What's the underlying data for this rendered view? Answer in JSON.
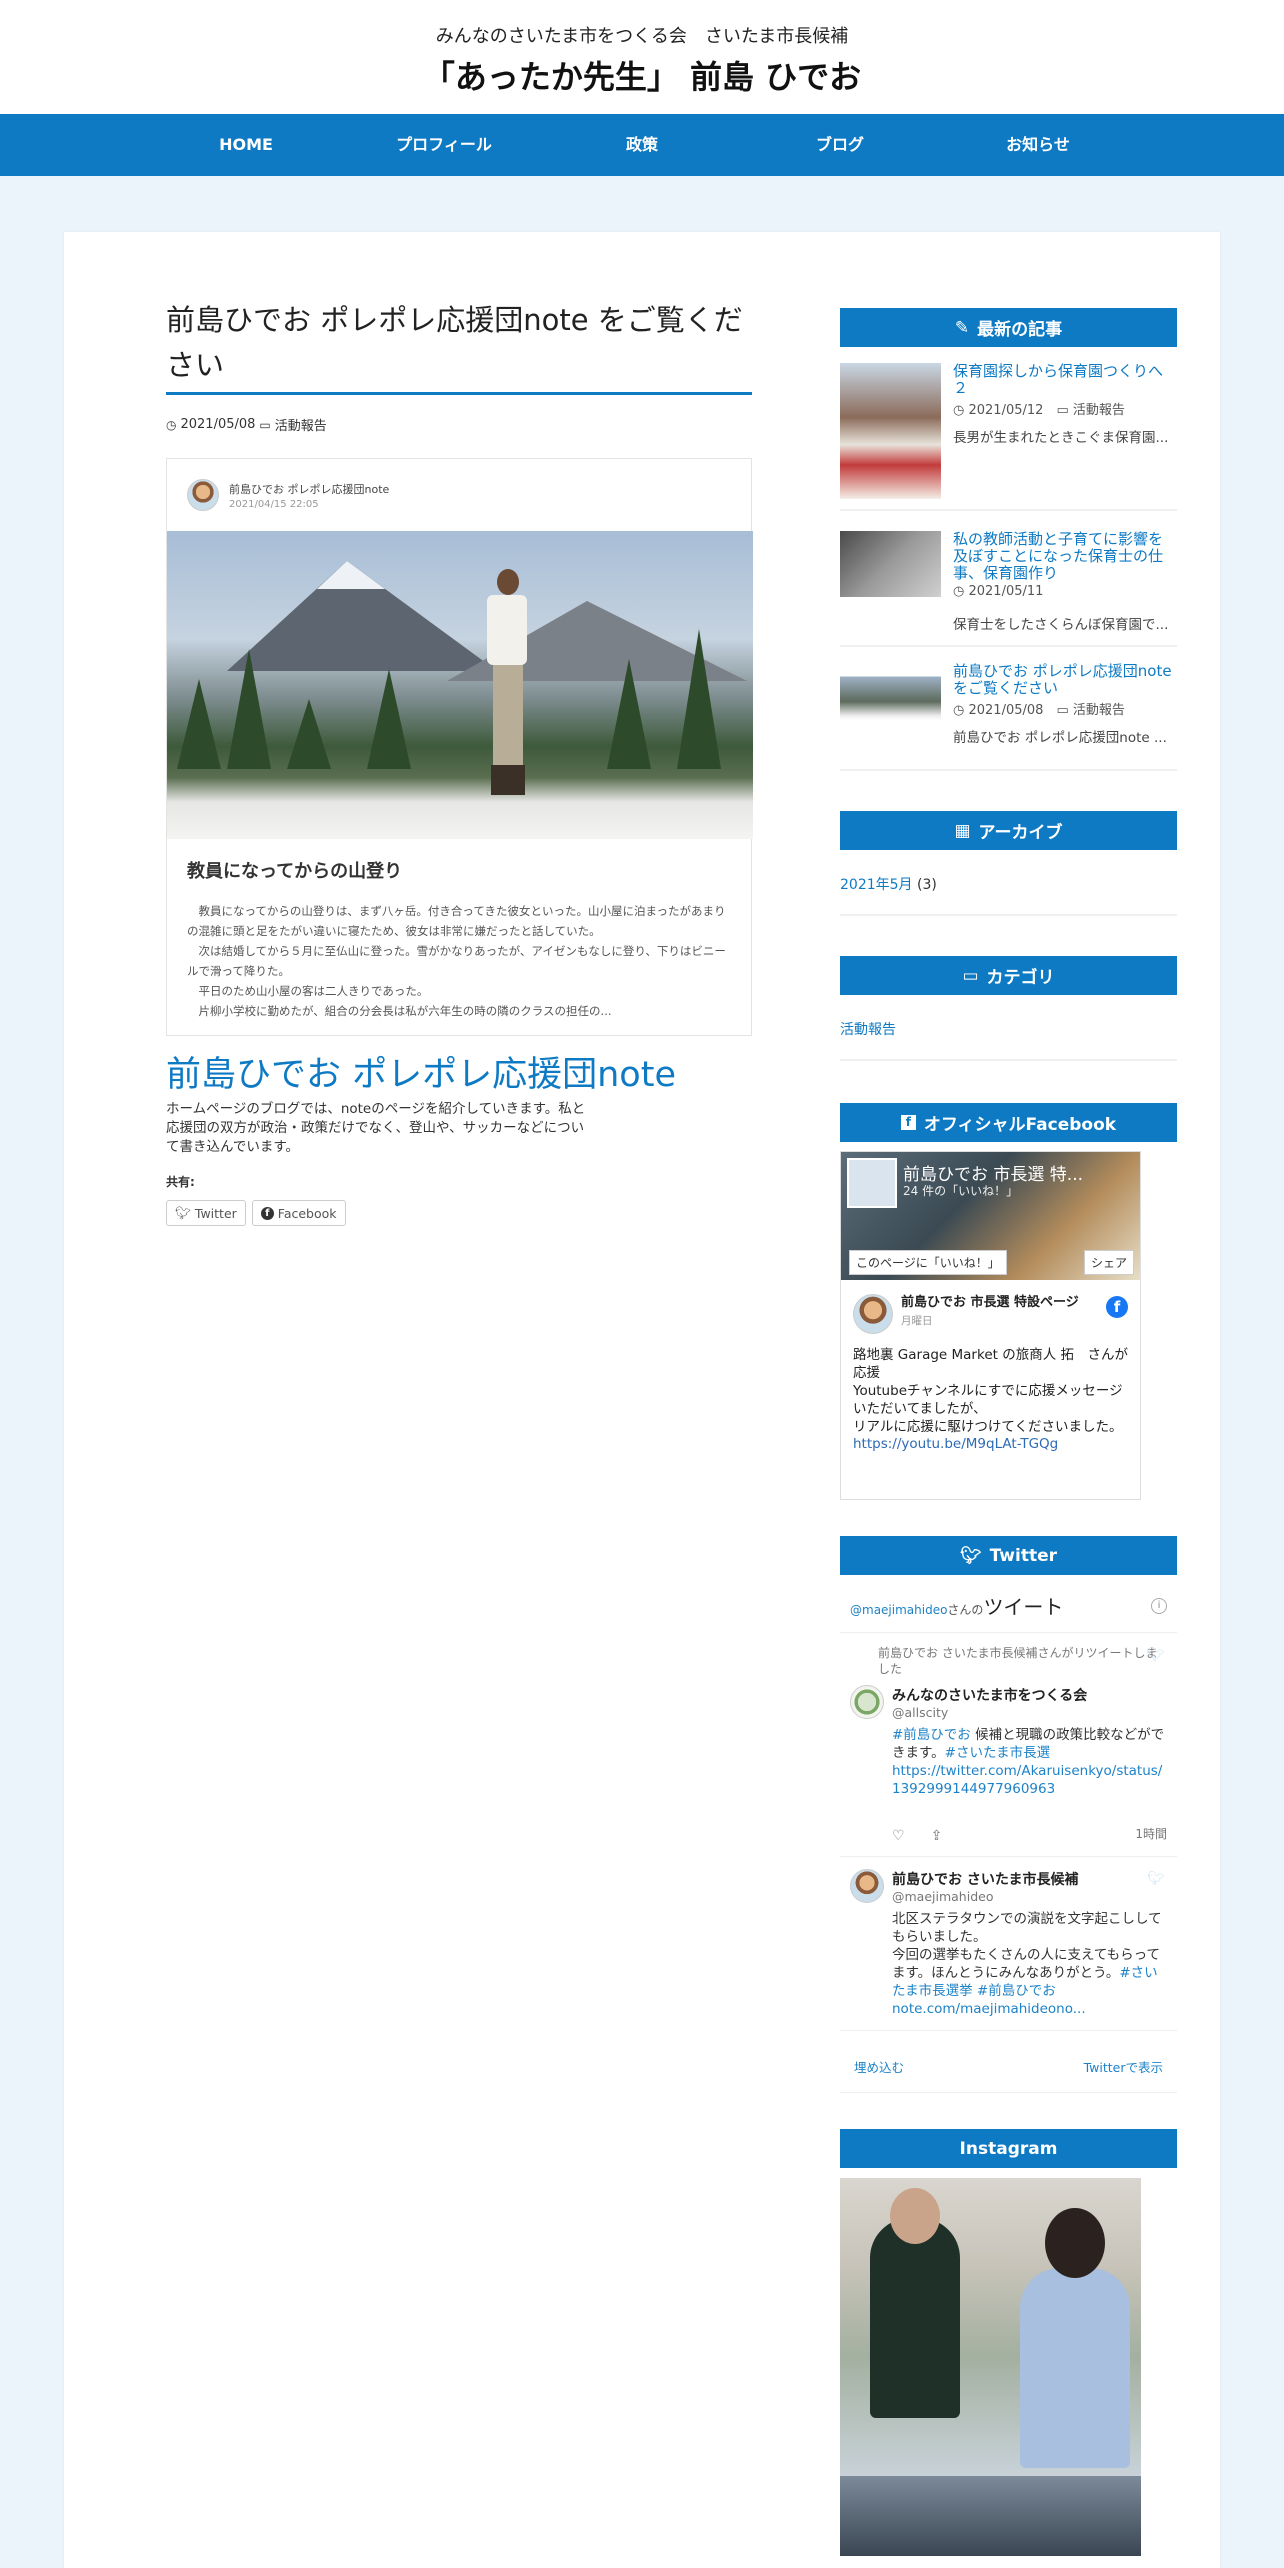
{
  "header": {
    "tagline": "みんなのさいたま市をつくる会　さいたま市長候補",
    "title": "「あったか先生」 前島 ひでお"
  },
  "nav": [
    "HOME",
    "プロフィール",
    "政策",
    "ブログ",
    "お知らせ"
  ],
  "article": {
    "title": "前島ひでお ポレポレ応援団note をご覧ください",
    "date": "2021/05/08",
    "category": "活動報告",
    "embed": {
      "author": "前島ひでお ポレポレ応援団note",
      "datetime": "2021/04/15 22:05",
      "heading": "教員になってからの山登り",
      "paragraphs": [
        "　教員になってからの山登りは、まず八ヶ岳。付き合ってきた彼女といった。山小屋に泊まったがあまりの混雑に頭と足をたがい違いに寝たため、彼女は非常に嫌だったと話していた。",
        "　次は結婚してから５月に至仏山に登った。雪がかなりあったが、アイゼンもなしに登り、下りはビニールで滑って降りた。",
        "　平日のため山小屋の客は二人きりであった。",
        "　片柳小学校に勤めたが、組合の分会長は私が六年生の時の隣のクラスの担任の..."
      ]
    },
    "link_text": "前島ひでお ポレポレ応援団note",
    "description": "ホームページのブログでは、noteのページを紹介していきます。私と応援団の双方が政治・政策だけでなく、登山や、サッカーなどについて書き込んでいます。",
    "share_label": "共有:",
    "share_twitter": "Twitter",
    "share_facebook": "Facebook"
  },
  "sidebar": {
    "recent_title": "最新の記事",
    "recent": [
      {
        "title": "保育園探しから保育園つくりへ ２",
        "date": "2021/05/12",
        "category": "活動報告",
        "excerpt": "長男が生まれたときこぐま保育園..."
      },
      {
        "title": "私の教師活動と子育てに影響を及ぼすことになった保育士の仕事、保育園作り",
        "date": "2021/05/11",
        "category": "",
        "excerpt": "保育士をしたさくらんぼ保育園で..."
      },
      {
        "title": "前島ひでお ポレポレ応援団note をご覧ください",
        "date": "2021/05/08",
        "category": "活動報告",
        "excerpt": "前島ひでお ポレポレ応援団note ..."
      }
    ],
    "archive_title": "アーカイブ",
    "archive_link": "2021年5月",
    "archive_count": "(3)",
    "category_title": "カテゴリ",
    "category_link": "活動報告",
    "facebook_title": "オフィシャルFacebook",
    "facebook": {
      "cover_title": "前島ひでお 市長選 特...",
      "cover_likes": "24 件の「いいね！」",
      "like_btn": "このページに「いいね！」",
      "share_btn": "シェア",
      "page_name": "前島ひでお 市長選 特設ページ",
      "day": "月曜日",
      "post_body": "路地裏 Garage Market の旅商人 拓　さんが応援\nYoutubeチャンネルにすでに応援メッセージいただいてましたが、\nリアルに応援に駆けつけてくださいました。",
      "post_link": "https://youtu.be/M9qLAt-TGQg"
    },
    "twitter_title": "Twitter",
    "twitter": {
      "handle_prefix": "@maejimahideo",
      "handle_suffix": "さんの",
      "tweets_label": "ツイート",
      "t1_rt": "前島ひでお さいたま市長候補さんがリツイートしました",
      "t1_name": "みんなのさいたま市をつくる会",
      "t1_handle": "@allscity",
      "t1_hashtag": "#前島ひでお",
      "t1_text1": " 候補と現職の政策比較などができます。",
      "t1_hashtag2": "#さいたま市長選",
      "t1_link": "https://twitter.com/Akaruisenkyo/status/1392999144977960963",
      "t1_time": "1時間",
      "t2_name": "前島ひでお さいたま市長候補",
      "t2_handle": "@maejimahideo",
      "t2_text": "北区ステラタウンでの演説を文字起こししてもらいました。\n今回の選挙もたくさんの人に支えてもらってます。ほんとうにみんなありがとう。",
      "t2_tags": "#さいたま市長選挙 #前島ひでお",
      "t2_link": "note.com/maejimahideono...",
      "embed_label": "埋め込む",
      "view_label": "Twitterで表示"
    },
    "instagram_title": "Instagram"
  },
  "colors": {
    "accent": "#0e7ac4",
    "background": "#ebf4fa"
  }
}
